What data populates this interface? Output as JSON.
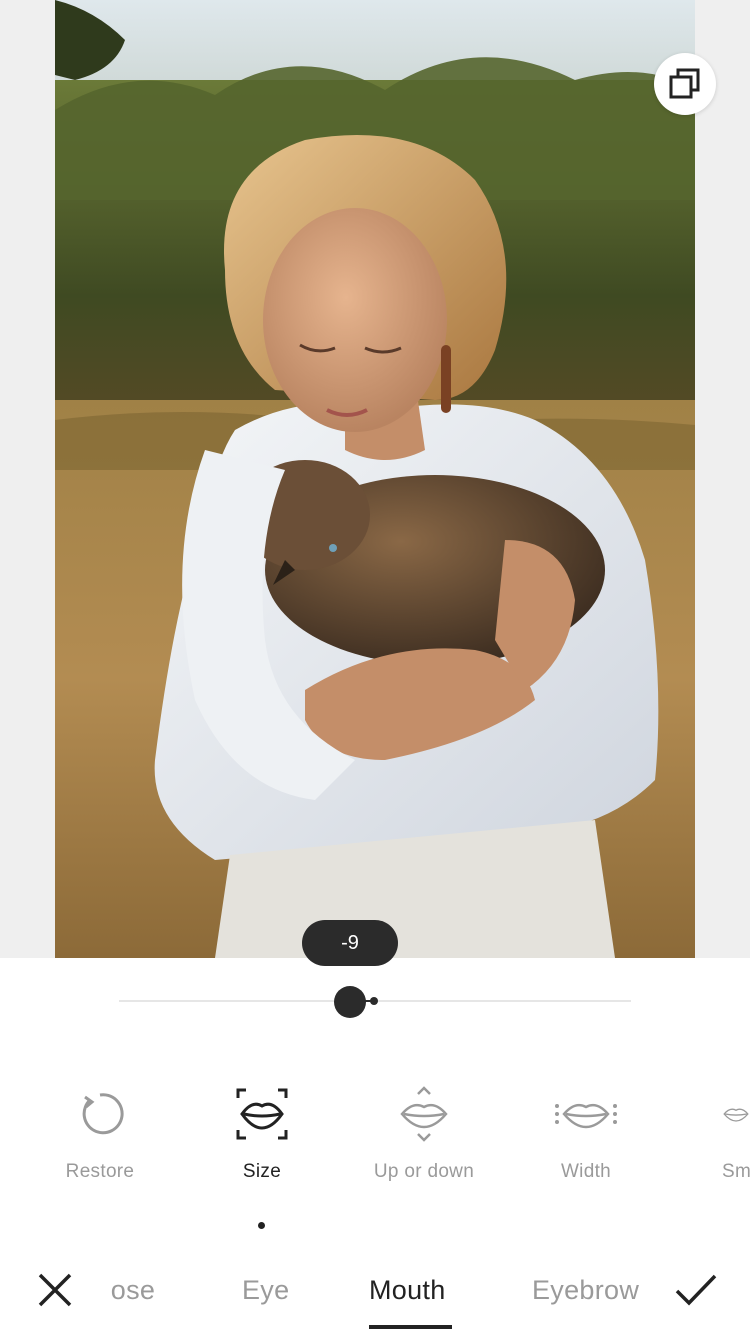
{
  "slider": {
    "value_label": "-9",
    "value": -9
  },
  "tools": [
    {
      "label": "Restore",
      "icon": "restore-icon",
      "active": false
    },
    {
      "label": "Size",
      "icon": "mouth-size-icon",
      "active": true
    },
    {
      "label": "Up or down",
      "icon": "mouth-up-down-icon",
      "active": false
    },
    {
      "label": "Width",
      "icon": "mouth-width-icon",
      "active": false
    },
    {
      "label": "Sm",
      "icon": "mouth-smile-icon",
      "active": false
    }
  ],
  "tabs": [
    {
      "label": "Nose",
      "active": false
    },
    {
      "label": "Eye",
      "active": false
    },
    {
      "label": "Mouth",
      "active": true
    },
    {
      "label": "Eyebrow",
      "active": false
    }
  ],
  "icons": {
    "compare": "compare-icon",
    "close": "close-icon",
    "confirm": "checkmark-icon"
  },
  "colors": {
    "accent": "#2b2b2b",
    "inactive_text": "#9a9a9a",
    "active_text": "#222222",
    "canvas_background": "#efefef"
  }
}
